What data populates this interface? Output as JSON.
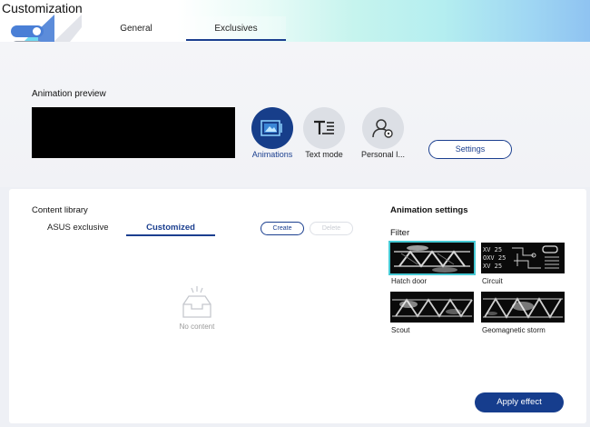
{
  "app": {
    "title": "Customization"
  },
  "tabs": [
    {
      "label": "General",
      "active": false
    },
    {
      "label": "Exclusives",
      "active": true
    }
  ],
  "preview": {
    "section_label": "Animation preview",
    "modes": [
      {
        "label": "Animations",
        "icon": "image-animation-icon",
        "active": true
      },
      {
        "label": "Text mode",
        "icon": "text-mode-icon",
        "active": false
      },
      {
        "label": "Personal I...",
        "icon": "personal-image-icon",
        "active": false
      }
    ],
    "settings_label": "Settings"
  },
  "library": {
    "title": "Content library",
    "tabs": [
      {
        "label": "ASUS exclusive",
        "active": false
      },
      {
        "label": "Customized",
        "active": true
      }
    ],
    "create_label": "Create",
    "delete_label": "Delete",
    "empty_text": "No content"
  },
  "animation_settings": {
    "title": "Animation settings",
    "filter_label": "Filter",
    "filters": [
      {
        "name": "Hatch door",
        "selected": true
      },
      {
        "name": "Circuit",
        "selected": false
      },
      {
        "name": "Scout",
        "selected": false
      },
      {
        "name": "Geomagnetic storm",
        "selected": false
      }
    ]
  },
  "apply_label": "Apply effect",
  "colors": {
    "accent": "#1b3f8f",
    "accent_dark": "#163d8d",
    "selection": "#46c9d4",
    "logo_blue": "#4a7fd6"
  }
}
